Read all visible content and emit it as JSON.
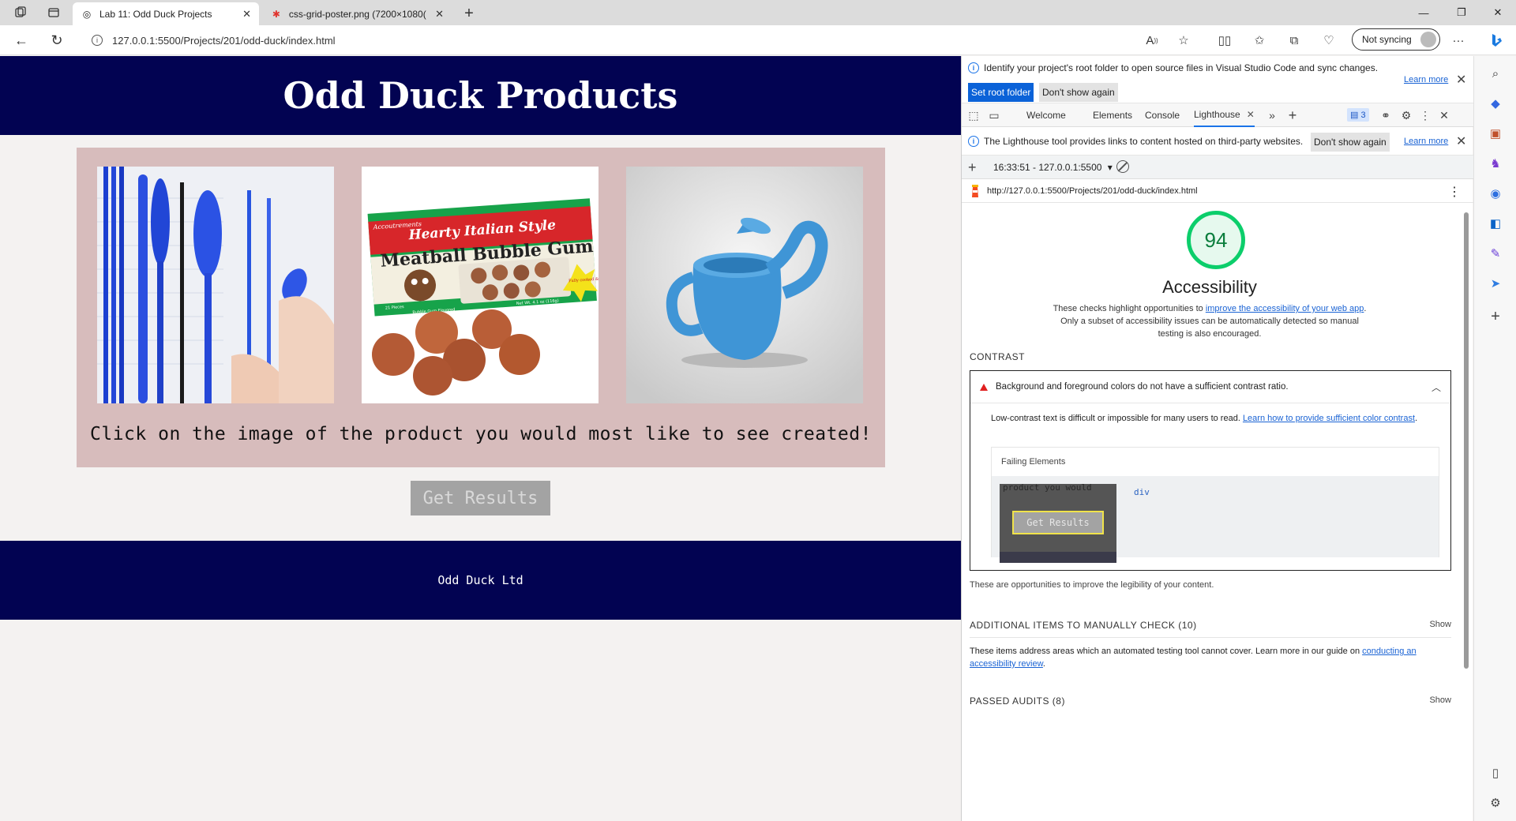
{
  "browser": {
    "tabs": [
      {
        "title": "Lab 11: Odd Duck Projects",
        "active": true
      },
      {
        "title": "css-grid-poster.png (7200×1080(",
        "active": false
      }
    ],
    "url": "127.0.0.1:5500/Projects/201/odd-duck/index.html",
    "sync_label": "Not syncing"
  },
  "page": {
    "title": "Odd Duck Products",
    "products": [
      {
        "name": "cutlery",
        "alt": "blue plastic utensils"
      },
      {
        "name": "bubblegum",
        "box_top": "Hearty Italian Style",
        "box_main": "Meatball Bubble Gum",
        "brand": "Accoutrements",
        "pieces": "21 Pieces",
        "flavor": "Bubble Gum Flavored",
        "net": "Net Wt. 4.1 oz (116g)",
        "burst": "Fully cooked & ready to chew!"
      },
      {
        "name": "water-can",
        "alt": "blue watering can"
      }
    ],
    "prompt": "Click on the image of the product you would most like to see created!",
    "results_button": "Get Results",
    "footer": "Odd Duck Ltd"
  },
  "devtools": {
    "vscode_banner": "Identify your project's root folder to open source files in Visual Studio Code and sync changes.",
    "learn_more": "Learn more",
    "set_root": "Set root folder",
    "dont_show": "Don't show again",
    "tabs": [
      "Welcome",
      "Elements",
      "Console",
      "Lighthouse"
    ],
    "issues_count": "3",
    "lh_banner": "The Lighthouse tool provides links to content hosted on third-party websites.",
    "report_select": "16:33:51 - 127.0.0.1:5500",
    "report_url": "http://127.0.0.1:5500/Projects/201/odd-duck/index.html",
    "score": "94",
    "category": "Accessibility",
    "desc_pre": "These checks highlight opportunities to ",
    "desc_link": "improve the accessibility of your web app",
    "desc_post": ". Only a subset of accessibility issues can be automatically detected so manual testing is also encouraged.",
    "contrast_header": "CONTRAST",
    "audit_title": "Background and foreground colors do not have a sufficient contrast ratio.",
    "audit_desc_pre": "Low-contrast text is difficult or impossible for many users to read. ",
    "audit_desc_link": "Learn how to provide sufficient color contrast",
    "audit_desc_post": ".",
    "failing_label": "Failing Elements",
    "failing_snippet_text": "product you would",
    "failing_button": "Get Results",
    "failing_node": "div",
    "contrast_footer": "These are opportunities to improve the legibility of your content.",
    "manual_header": "ADDITIONAL ITEMS TO MANUALLY CHECK (10)",
    "show": "Show",
    "manual_desc_pre": "These items address areas which an automated testing tool cannot cover. Learn more in our guide on ",
    "manual_desc_link": "conducting an accessibility review",
    "manual_desc_post": ".",
    "passed_header": "PASSED AUDITS (8)"
  }
}
